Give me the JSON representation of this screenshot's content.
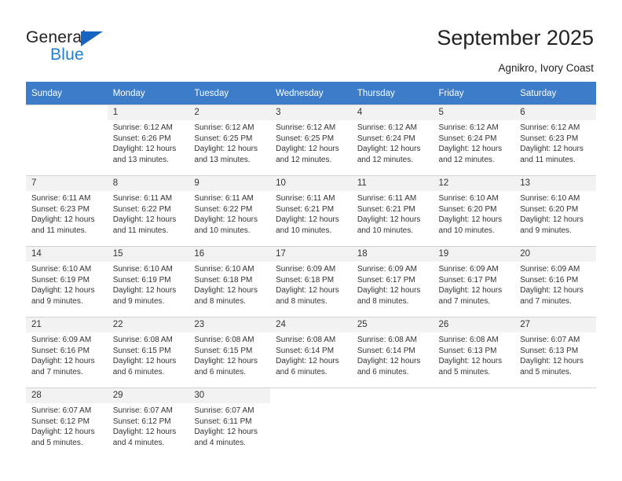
{
  "brand": {
    "name_part1": "General",
    "name_part2": "Blue",
    "accent_color": "#1f7fd4",
    "triangle_color": "#1565c0"
  },
  "header": {
    "title": "September 2025",
    "subtitle": "Agnikro, Ivory Coast"
  },
  "calendar": {
    "header_bg": "#3d7cc9",
    "header_text_color": "#ffffff",
    "weekdays": [
      "Sunday",
      "Monday",
      "Tuesday",
      "Wednesday",
      "Thursday",
      "Friday",
      "Saturday"
    ],
    "labels": {
      "sunrise": "Sunrise:",
      "sunset": "Sunset:",
      "daylight": "Daylight:"
    },
    "weeks": [
      [
        {
          "day": "",
          "line1": "",
          "line2": "",
          "line3": "",
          "line4": ""
        },
        {
          "day": "1",
          "line1": "Sunrise: 6:12 AM",
          "line2": "Sunset: 6:26 PM",
          "line3": "Daylight: 12 hours",
          "line4": "and 13 minutes."
        },
        {
          "day": "2",
          "line1": "Sunrise: 6:12 AM",
          "line2": "Sunset: 6:25 PM",
          "line3": "Daylight: 12 hours",
          "line4": "and 13 minutes."
        },
        {
          "day": "3",
          "line1": "Sunrise: 6:12 AM",
          "line2": "Sunset: 6:25 PM",
          "line3": "Daylight: 12 hours",
          "line4": "and 12 minutes."
        },
        {
          "day": "4",
          "line1": "Sunrise: 6:12 AM",
          "line2": "Sunset: 6:24 PM",
          "line3": "Daylight: 12 hours",
          "line4": "and 12 minutes."
        },
        {
          "day": "5",
          "line1": "Sunrise: 6:12 AM",
          "line2": "Sunset: 6:24 PM",
          "line3": "Daylight: 12 hours",
          "line4": "and 12 minutes."
        },
        {
          "day": "6",
          "line1": "Sunrise: 6:12 AM",
          "line2": "Sunset: 6:23 PM",
          "line3": "Daylight: 12 hours",
          "line4": "and 11 minutes."
        }
      ],
      [
        {
          "day": "7",
          "line1": "Sunrise: 6:11 AM",
          "line2": "Sunset: 6:23 PM",
          "line3": "Daylight: 12 hours",
          "line4": "and 11 minutes."
        },
        {
          "day": "8",
          "line1": "Sunrise: 6:11 AM",
          "line2": "Sunset: 6:22 PM",
          "line3": "Daylight: 12 hours",
          "line4": "and 11 minutes."
        },
        {
          "day": "9",
          "line1": "Sunrise: 6:11 AM",
          "line2": "Sunset: 6:22 PM",
          "line3": "Daylight: 12 hours",
          "line4": "and 10 minutes."
        },
        {
          "day": "10",
          "line1": "Sunrise: 6:11 AM",
          "line2": "Sunset: 6:21 PM",
          "line3": "Daylight: 12 hours",
          "line4": "and 10 minutes."
        },
        {
          "day": "11",
          "line1": "Sunrise: 6:11 AM",
          "line2": "Sunset: 6:21 PM",
          "line3": "Daylight: 12 hours",
          "line4": "and 10 minutes."
        },
        {
          "day": "12",
          "line1": "Sunrise: 6:10 AM",
          "line2": "Sunset: 6:20 PM",
          "line3": "Daylight: 12 hours",
          "line4": "and 10 minutes."
        },
        {
          "day": "13",
          "line1": "Sunrise: 6:10 AM",
          "line2": "Sunset: 6:20 PM",
          "line3": "Daylight: 12 hours",
          "line4": "and 9 minutes."
        }
      ],
      [
        {
          "day": "14",
          "line1": "Sunrise: 6:10 AM",
          "line2": "Sunset: 6:19 PM",
          "line3": "Daylight: 12 hours",
          "line4": "and 9 minutes."
        },
        {
          "day": "15",
          "line1": "Sunrise: 6:10 AM",
          "line2": "Sunset: 6:19 PM",
          "line3": "Daylight: 12 hours",
          "line4": "and 9 minutes."
        },
        {
          "day": "16",
          "line1": "Sunrise: 6:10 AM",
          "line2": "Sunset: 6:18 PM",
          "line3": "Daylight: 12 hours",
          "line4": "and 8 minutes."
        },
        {
          "day": "17",
          "line1": "Sunrise: 6:09 AM",
          "line2": "Sunset: 6:18 PM",
          "line3": "Daylight: 12 hours",
          "line4": "and 8 minutes."
        },
        {
          "day": "18",
          "line1": "Sunrise: 6:09 AM",
          "line2": "Sunset: 6:17 PM",
          "line3": "Daylight: 12 hours",
          "line4": "and 8 minutes."
        },
        {
          "day": "19",
          "line1": "Sunrise: 6:09 AM",
          "line2": "Sunset: 6:17 PM",
          "line3": "Daylight: 12 hours",
          "line4": "and 7 minutes."
        },
        {
          "day": "20",
          "line1": "Sunrise: 6:09 AM",
          "line2": "Sunset: 6:16 PM",
          "line3": "Daylight: 12 hours",
          "line4": "and 7 minutes."
        }
      ],
      [
        {
          "day": "21",
          "line1": "Sunrise: 6:09 AM",
          "line2": "Sunset: 6:16 PM",
          "line3": "Daylight: 12 hours",
          "line4": "and 7 minutes."
        },
        {
          "day": "22",
          "line1": "Sunrise: 6:08 AM",
          "line2": "Sunset: 6:15 PM",
          "line3": "Daylight: 12 hours",
          "line4": "and 6 minutes."
        },
        {
          "day": "23",
          "line1": "Sunrise: 6:08 AM",
          "line2": "Sunset: 6:15 PM",
          "line3": "Daylight: 12 hours",
          "line4": "and 6 minutes."
        },
        {
          "day": "24",
          "line1": "Sunrise: 6:08 AM",
          "line2": "Sunset: 6:14 PM",
          "line3": "Daylight: 12 hours",
          "line4": "and 6 minutes."
        },
        {
          "day": "25",
          "line1": "Sunrise: 6:08 AM",
          "line2": "Sunset: 6:14 PM",
          "line3": "Daylight: 12 hours",
          "line4": "and 6 minutes."
        },
        {
          "day": "26",
          "line1": "Sunrise: 6:08 AM",
          "line2": "Sunset: 6:13 PM",
          "line3": "Daylight: 12 hours",
          "line4": "and 5 minutes."
        },
        {
          "day": "27",
          "line1": "Sunrise: 6:07 AM",
          "line2": "Sunset: 6:13 PM",
          "line3": "Daylight: 12 hours",
          "line4": "and 5 minutes."
        }
      ],
      [
        {
          "day": "28",
          "line1": "Sunrise: 6:07 AM",
          "line2": "Sunset: 6:12 PM",
          "line3": "Daylight: 12 hours",
          "line4": "and 5 minutes."
        },
        {
          "day": "29",
          "line1": "Sunrise: 6:07 AM",
          "line2": "Sunset: 6:12 PM",
          "line3": "Daylight: 12 hours",
          "line4": "and 4 minutes."
        },
        {
          "day": "30",
          "line1": "Sunrise: 6:07 AM",
          "line2": "Sunset: 6:11 PM",
          "line3": "Daylight: 12 hours",
          "line4": "and 4 minutes."
        },
        {
          "day": "",
          "line1": "",
          "line2": "",
          "line3": "",
          "line4": ""
        },
        {
          "day": "",
          "line1": "",
          "line2": "",
          "line3": "",
          "line4": ""
        },
        {
          "day": "",
          "line1": "",
          "line2": "",
          "line3": "",
          "line4": ""
        },
        {
          "day": "",
          "line1": "",
          "line2": "",
          "line3": "",
          "line4": ""
        }
      ]
    ]
  }
}
